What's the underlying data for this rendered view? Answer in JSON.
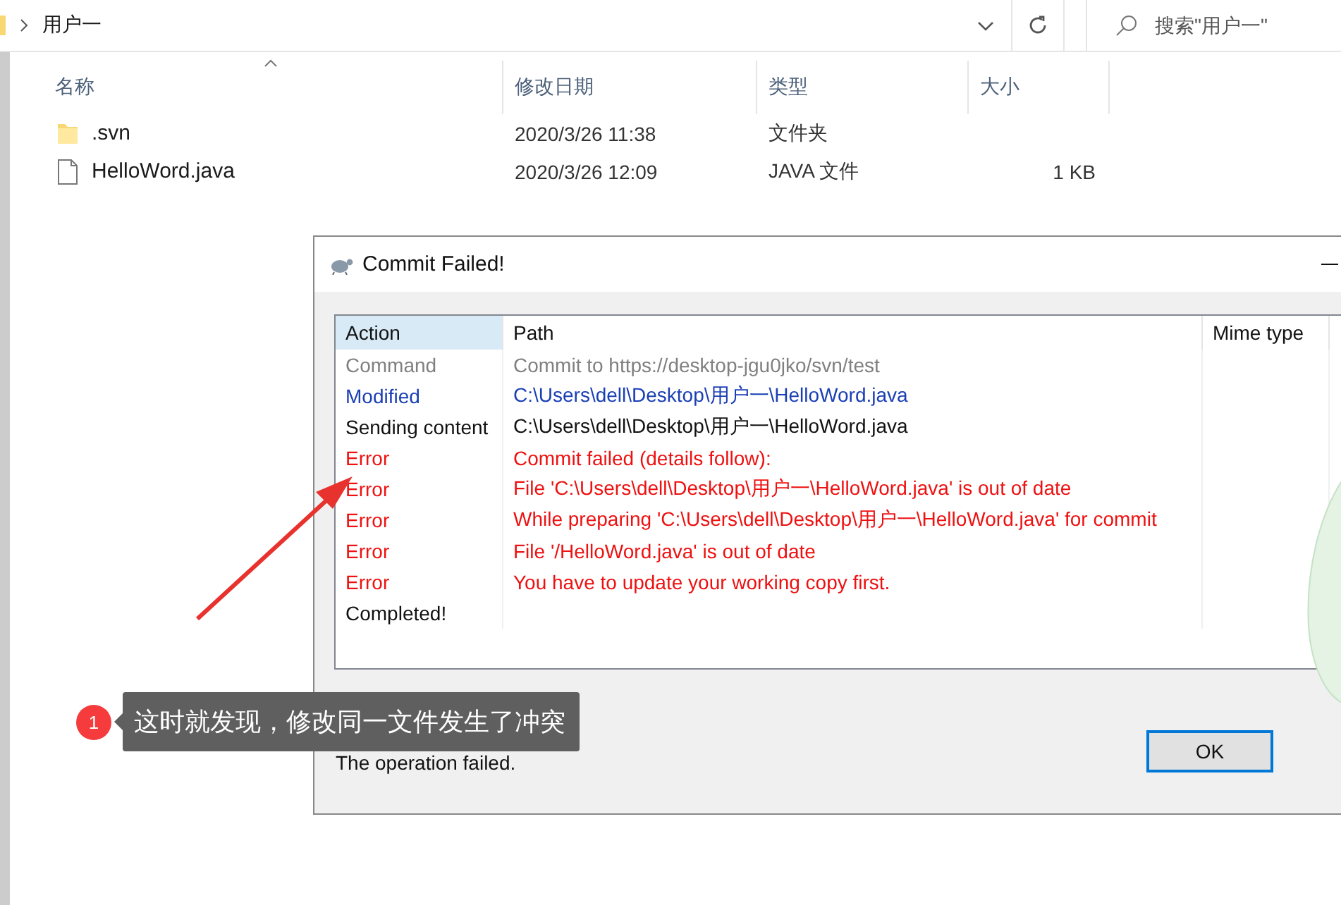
{
  "explorer": {
    "breadcrumb": "用户一",
    "search": {
      "placeholder": "搜索\"用户一\""
    },
    "columns": [
      "名称",
      "修改日期",
      "类型",
      "大小"
    ],
    "files": [
      {
        "kind": "folder",
        "name": ".svn",
        "modified": "2020/3/26 11:38",
        "type": "文件夹"
      },
      {
        "kind": "file",
        "name": "HelloWord.java",
        "modified": "2020/3/26 12:09",
        "type": "JAVA 文件",
        "size": "1 KB"
      }
    ]
  },
  "dialog": {
    "title": "Commit Failed!",
    "columns": [
      {
        "label": "Action",
        "selected": true
      },
      {
        "label": "Path",
        "selected": false
      },
      {
        "label": "Mime type",
        "selected": false
      }
    ],
    "rows": [
      {
        "kind": "command",
        "action": "Command",
        "path": "Commit to https://desktop-jgu0jko/svn/test"
      },
      {
        "kind": "modified",
        "action": "Modified",
        "path": "C:\\Users\\dell\\Desktop\\用户一\\HelloWord.java"
      },
      {
        "kind": "sending",
        "action": "Sending content",
        "path": "C:\\Users\\dell\\Desktop\\用户一\\HelloWord.java"
      },
      {
        "kind": "error",
        "action": "Error",
        "path": "Commit failed (details follow):"
      },
      {
        "kind": "error",
        "action": "Error",
        "path": "File 'C:\\Users\\dell\\Desktop\\用户一\\HelloWord.java' is out of date"
      },
      {
        "kind": "error",
        "action": "Error",
        "path": "While preparing 'C:\\Users\\dell\\Desktop\\用户一\\HelloWord.java' for commit"
      },
      {
        "kind": "error",
        "action": "Error",
        "path": "File '/HelloWord.java' is out of date"
      },
      {
        "kind": "error",
        "action": "Error",
        "path": "You have to update your working copy first."
      },
      {
        "kind": "completed",
        "action": "Completed!"
      }
    ],
    "status": "The operation failed.",
    "button": "OK"
  },
  "callout": {
    "number": "1",
    "text": "这时就发现，修改同一文件发生了冲突"
  }
}
